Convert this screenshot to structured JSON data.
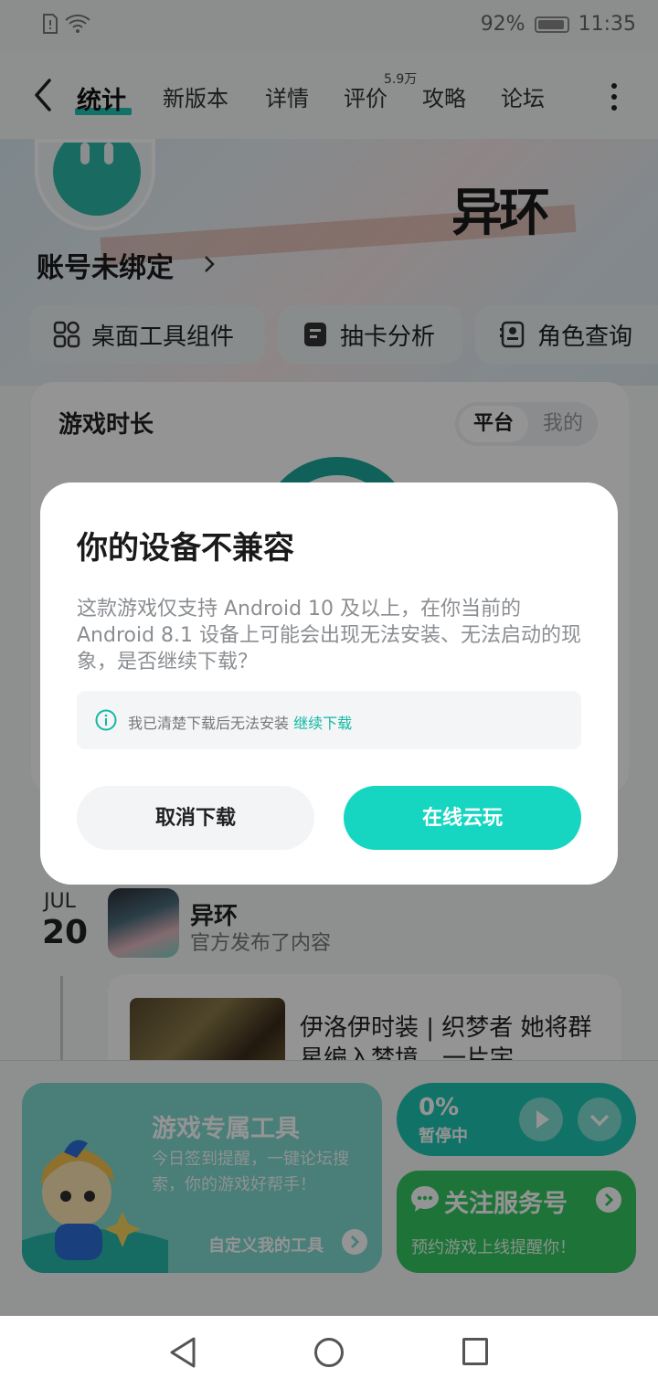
{
  "status_bar": {
    "battery": "92%",
    "time": "11:35",
    "battery_level": 0.92
  },
  "nav": {
    "tabs": [
      {
        "label": "统计",
        "active": true
      },
      {
        "label": "新版本"
      },
      {
        "label": "详情"
      },
      {
        "label": "评价",
        "badge": "5.9万"
      },
      {
        "label": "攻略"
      },
      {
        "label": "论坛"
      }
    ]
  },
  "hero": {
    "game_logo": "异环",
    "account_status": "账号未绑定",
    "tools": [
      {
        "label": "桌面工具组件",
        "icon": "widget-grid-icon"
      },
      {
        "label": "抽卡分析",
        "icon": "document-list-icon"
      },
      {
        "label": "角色查询",
        "icon": "profile-card-icon"
      }
    ]
  },
  "stats": {
    "title": "游戏时长",
    "segments": [
      "平台",
      "我的"
    ]
  },
  "feed": {
    "month": "JUL",
    "day": "20",
    "author": "异环",
    "action": "官方发布了内容",
    "post_title": "伊洛伊时装 | 织梦者 她将群星编入梦境，一片宇"
  },
  "bottom": {
    "tool_card": {
      "title": "游戏专属工具",
      "desc": "今日签到提醒，一键论坛搜索，你的游戏好帮手！",
      "link": "自定义我的工具"
    },
    "download": {
      "percent": "0%",
      "state": "暂停中",
      "progress": 0.0
    },
    "follow": {
      "title": "关注服务号",
      "desc": "预约游戏上线提醒你！"
    }
  },
  "dialog": {
    "title": "你的设备不兼容",
    "body": "这款游戏仅支持 Android 10 及以上，在你当前的 Android 8.1 设备上可能会出现无法安装、无法启动的现象，是否继续下载？",
    "note": "我已清楚下载后无法安装",
    "note_link": "继续下载",
    "cancel": "取消下载",
    "confirm": "在线云玩"
  },
  "colors": {
    "accent": "#17d6c1",
    "teal_dark": "#1ba79a",
    "green": "#35c763"
  }
}
